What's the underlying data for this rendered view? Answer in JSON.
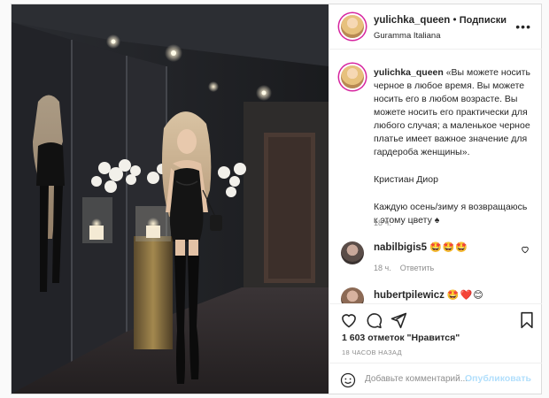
{
  "post": {
    "username": "yulichka_queen",
    "separator": " • ",
    "follow_label": "Подписки",
    "location": "Guramma Italiana",
    "more_icon": "more-horizontal-icon"
  },
  "caption": {
    "username": "yulichka_queen",
    "paragraph1": "«Вы можете носить черное в любое время. Вы можете носить его в любом возрасте. Вы можете носить его практически для любого случая; а маленькое черное платье имеет важное значение для гардероба женщины».",
    "paragraph2": "Кристиан Диор",
    "paragraph3": "Каждую осень/зиму я возвращаюсь к этому цвету ♠",
    "time": "18 ч."
  },
  "comments": [
    {
      "username": "nabilbigis5",
      "text": "🤩🤩🤩",
      "time": "18 ч.",
      "reply_label": "Ответить"
    },
    {
      "username": "hubertpilewicz",
      "text": "🤩❤️😊"
    }
  ],
  "actions": {
    "likes": "1 603 отметок \"Нравится\"",
    "time_ago": "18 ЧАСОВ НАЗАД"
  },
  "add_comment": {
    "placeholder": "Добавьте комментарий...",
    "publish_label": "Опубликовать"
  },
  "colors": {
    "text": "#262626",
    "secondary": "#8e8e8e",
    "publish_disabled": "#b2dffc",
    "story_ring": "#d6249f"
  }
}
